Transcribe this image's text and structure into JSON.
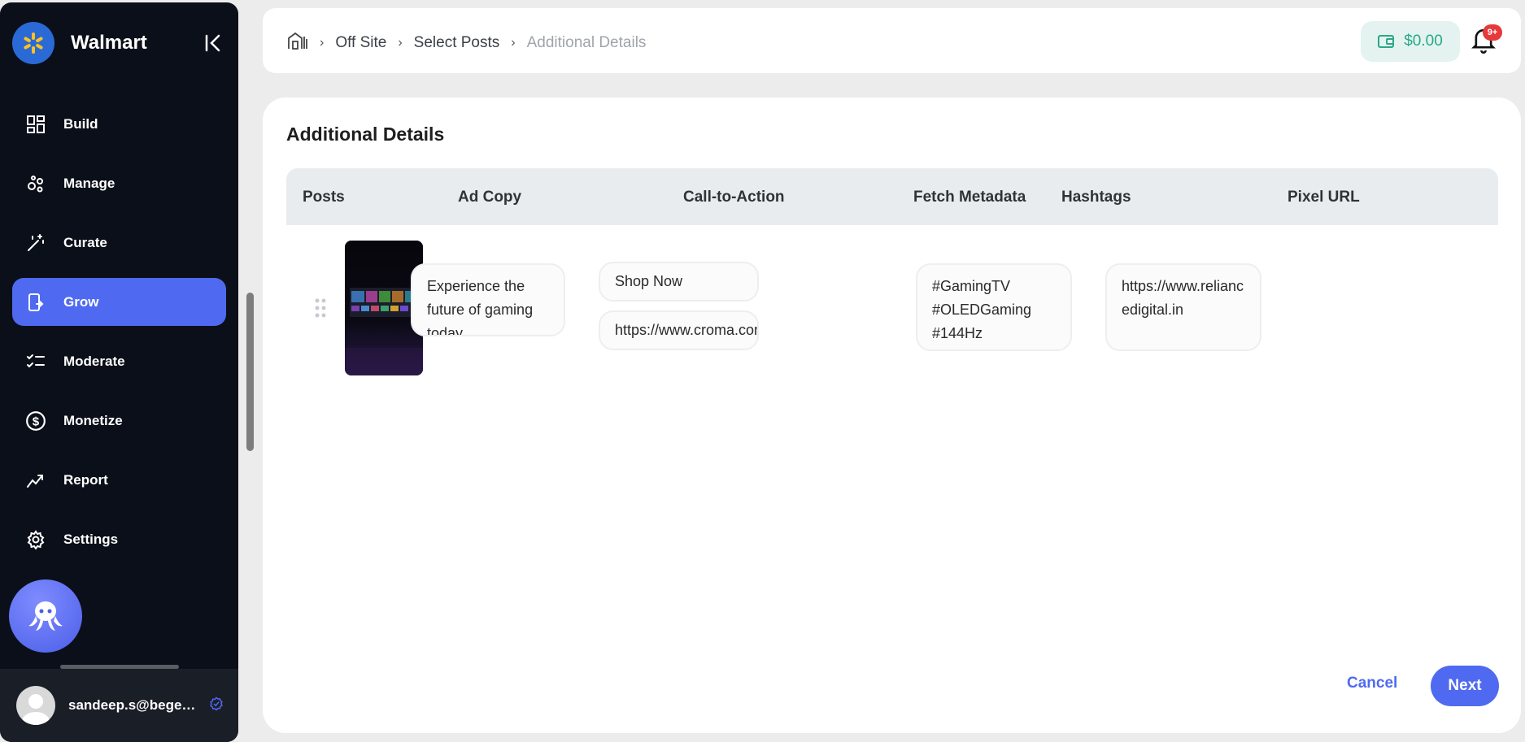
{
  "sidebar": {
    "brand": "Walmart",
    "items": [
      {
        "label": "Build",
        "icon": "build-icon"
      },
      {
        "label": "Manage",
        "icon": "manage-icon"
      },
      {
        "label": "Curate",
        "icon": "curate-wand-icon"
      },
      {
        "label": "Grow",
        "icon": "grow-icon",
        "active": true
      },
      {
        "label": "Moderate",
        "icon": "moderate-checklist-icon"
      },
      {
        "label": "Monetize",
        "icon": "dollar-icon"
      },
      {
        "label": "Report",
        "icon": "report-trend-icon"
      },
      {
        "label": "Settings",
        "icon": "gear-icon"
      }
    ],
    "user_email": "sandeep.s@begenuin.com"
  },
  "header": {
    "breadcrumbs": [
      "Off Site",
      "Select Posts",
      "Additional Details"
    ],
    "wallet": "$0.00",
    "notification_badge": "9+"
  },
  "main": {
    "title": "Additional Details",
    "columns": [
      "Posts",
      "Ad Copy",
      "Call-to-Action",
      "Fetch Metadata",
      "Hashtags",
      "Pixel URL"
    ],
    "row": {
      "ad_copy": "Experience the future of gaming today.",
      "cta_label": "Shop Now",
      "cta_url": "https://www.croma.com",
      "fetch_metadata": true,
      "hashtags": [
        "#GamingTV",
        "#OLEDGaming",
        "#144Hz"
      ],
      "pixel_url": "https://www.reliancedigital.in"
    },
    "cancel_label": "Cancel",
    "next_label": "Next"
  },
  "colors": {
    "accent": "#4f6af0",
    "sidebar_bg": "#0b0f19",
    "wallet_text": "#2aa88a",
    "badge": "#e5393b"
  }
}
